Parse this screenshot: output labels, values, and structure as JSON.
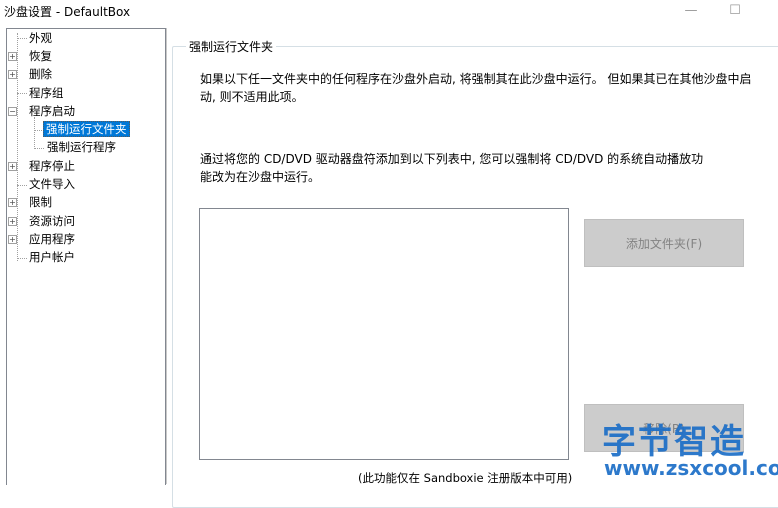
{
  "window": {
    "title": "沙盘设置 - DefaultBox",
    "min_glyph": "—",
    "max_glyph": "☐"
  },
  "tree": {
    "items": [
      {
        "label": "外观"
      },
      {
        "label": "恢复"
      },
      {
        "label": "删除"
      },
      {
        "label": "程序组"
      },
      {
        "label": "程序启动"
      },
      {
        "label": "强制运行文件夹",
        "selected": true
      },
      {
        "label": "强制运行程序"
      },
      {
        "label": "程序停止"
      },
      {
        "label": "文件导入"
      },
      {
        "label": "限制"
      },
      {
        "label": "资源访问"
      },
      {
        "label": "应用程序"
      },
      {
        "label": "用户帐户"
      }
    ]
  },
  "panel": {
    "group_title": "强制运行文件夹",
    "description_line1": "如果以下任一文件夹中的任何程序在沙盘外启动, 将强制其在此沙盘中运行。 但如果其已在其他沙盘中启",
    "description_line2": "动, 则不适用此项。",
    "cd_line1": "通过将您的 CD/DVD 驱动器盘符添加到以下列表中, 您可以强制将 CD/DVD 的系统自动播放功",
    "cd_line2": "能改为在沙盘中运行。",
    "add_folder_button": "添加文件夹(F)",
    "remove_button": "移除(R)",
    "footnote": "(此功能仅在 Sandboxie 注册版本中可用)"
  },
  "watermark": {
    "line1": "字节智造",
    "line2": "www.zsxcool.com"
  }
}
